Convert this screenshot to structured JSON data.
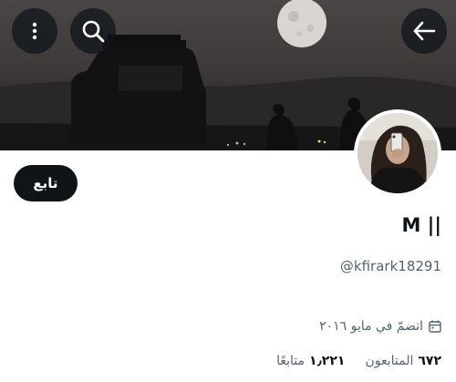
{
  "header": {
    "back_icon": "arrow-left-icon",
    "search_icon": "search-icon",
    "more_icon": "more-vertical-icon"
  },
  "profile": {
    "follow_label": "تابع",
    "display_name": "M ||",
    "handle": "@kfirark18291",
    "joined": "انضمّ في مايو ٢٠١٦",
    "joined_icon": "calendar-icon",
    "followers_count": "٦٧٢",
    "followers_label": "المتابعون",
    "following_count": "١٫٢٢١",
    "following_label": "متابعًا"
  },
  "colors": {
    "primary_text": "#0f1419",
    "secondary_text": "#536471",
    "button_dark": "#0f1419"
  }
}
